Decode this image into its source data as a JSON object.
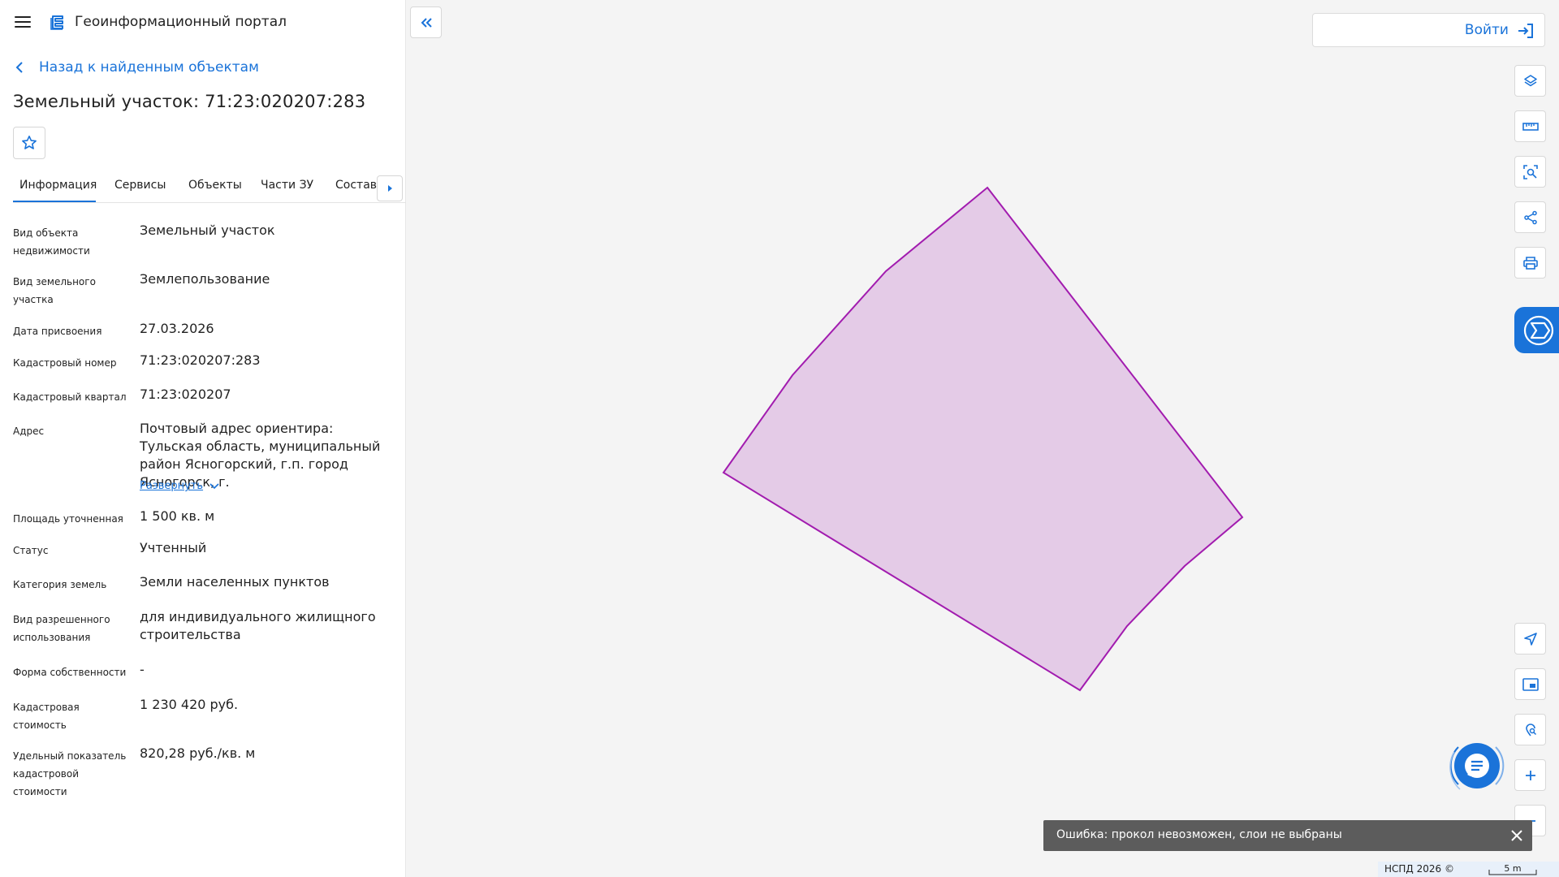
{
  "header": {
    "title": "Геоинформационный портал",
    "menu_icon": "menu-icon",
    "logo_icon": "portal-logo-icon"
  },
  "back_link": {
    "label": "Назад к найденным объектам"
  },
  "object": {
    "title": "Земельный участок: 71:23:020207:283"
  },
  "tabs": [
    {
      "label": "Информация",
      "active": true
    },
    {
      "label": "Сервисы",
      "active": false
    },
    {
      "label": "Объекты",
      "active": false
    },
    {
      "label": "Части ЗУ",
      "active": false
    },
    {
      "label": "Состав",
      "active": false
    }
  ],
  "properties": [
    {
      "label": "Вид объекта недвижимости",
      "value": "Земельный участок"
    },
    {
      "label": "Вид земельного участка",
      "value": "Землепользование"
    },
    {
      "label": "Дата присвоения",
      "value": "27.03.2026"
    },
    {
      "label": "Кадастровый номер",
      "value": "71:23:020207:283"
    },
    {
      "label": "Кадастровый квартал",
      "value": "71:23:020207"
    },
    {
      "label": "Адрес",
      "value": "Почтовый адрес ориентира: Тульская область, муниципальный район Ясногорский, г.п. город Ясногорск, г."
    },
    {
      "label": "Площадь уточненная",
      "value": "1 500 кв. м"
    },
    {
      "label": "Статус",
      "value": "Учтенный"
    },
    {
      "label": "Категория земель",
      "value": "Земли населенных пунктов"
    },
    {
      "label": "Вид разрешенного использования",
      "value": "для индивидуального жилищного строительства"
    },
    {
      "label": "Форма собственности",
      "value": "-"
    },
    {
      "label": "Кадастровая стоимость",
      "value": "1 230 420 руб."
    },
    {
      "label": "Удельный показатель кадастровой стоимости",
      "value": "820,28 руб./кв. м"
    }
  ],
  "expand_label": "Развернуть",
  "map": {
    "login_label": "Войти",
    "parcel_fill": "#e4cbe7",
    "parcel_stroke": "#a21caf",
    "tools": [
      "layers-icon",
      "ruler-icon",
      "select-area-icon",
      "share-icon",
      "print-icon"
    ],
    "bottom_tools": [
      "locate-icon",
      "minimap-icon",
      "geo-search-icon",
      "zoom-in-icon",
      "zoom-out-icon"
    ],
    "toast": "Ошибка: прокол невозможен, слои не выбраны",
    "copyright": "НСПД 2026 ©",
    "scale_label": "5 m"
  },
  "colors": {
    "accent": "#1a73d9",
    "toast_bg": "#5c5c5c"
  }
}
